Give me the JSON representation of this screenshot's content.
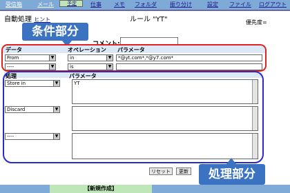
{
  "tabs": [
    "受信箱",
    "メール",
    "予定",
    "仕事",
    "メモ",
    "フォルダ",
    "振り分け",
    "設定",
    "ファイル",
    "ログアウト"
  ],
  "tab_selected_index": 2,
  "header": {
    "title": "自動処理",
    "hint_link": "ヒント",
    "rule_title": "ルール \"YT\"",
    "priority_label": "優先度="
  },
  "callouts": {
    "condition": "条件部分",
    "action": "処理部分"
  },
  "comment": {
    "label": "コメント:",
    "value": ""
  },
  "condition": {
    "headers": {
      "data": "データ",
      "operation": "オペレーション",
      "parameter": "パラメータ"
    },
    "rows": [
      {
        "data": "From",
        "operation": "in",
        "parameter": "*@yt.com*,*@y7.com*"
      },
      {
        "data": "----",
        "operation": "is",
        "parameter": ""
      }
    ]
  },
  "action": {
    "headers": {
      "process": "処理",
      "parameter": "パラメータ"
    },
    "rows": [
      {
        "action": "Store in",
        "parameter": "YT"
      },
      {
        "action": "Discard",
        "parameter": ""
      },
      {
        "action": "----",
        "parameter": ""
      }
    ]
  },
  "buttons": {
    "reset": "リセット",
    "update": "更新"
  },
  "bottom_tab": "【新規作成】"
}
